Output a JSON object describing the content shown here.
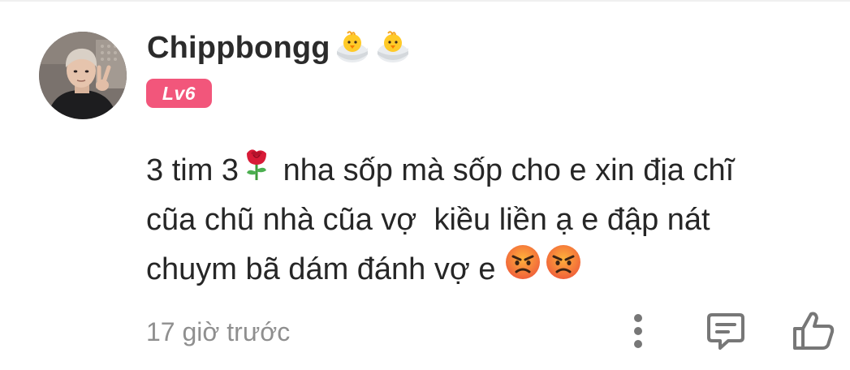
{
  "comment": {
    "username": "Chippbongg",
    "username_emojis": [
      "hatching-chick-emoji",
      "hatching-chick-emoji"
    ],
    "level_badge": "Lv6",
    "text_lines": [
      {
        "before": "3 tim 3",
        "emoji": "rose-emoji",
        "after": " nha sốp mà sốp cho e xin địa chĩ"
      },
      {
        "before": "cũa chũ nhà cũa vợ  kiều liền ạ e đập nát",
        "emoji": "",
        "after": ""
      },
      {
        "before": "chuym bã dám đánh vợ e",
        "emoji": "angry-face-emoji",
        "emoji_count": 2,
        "after": ""
      }
    ],
    "timestamp": "17 giờ trước"
  },
  "actions": {
    "icons": [
      "more-vertical-icon",
      "reply-comment-icon",
      "like-thumbs-up-icon"
    ]
  },
  "colors": {
    "text_primary": "#262626",
    "text_secondary": "#8f8f8f",
    "badge_bg": "#f2567b",
    "icon_color": "#777777"
  }
}
